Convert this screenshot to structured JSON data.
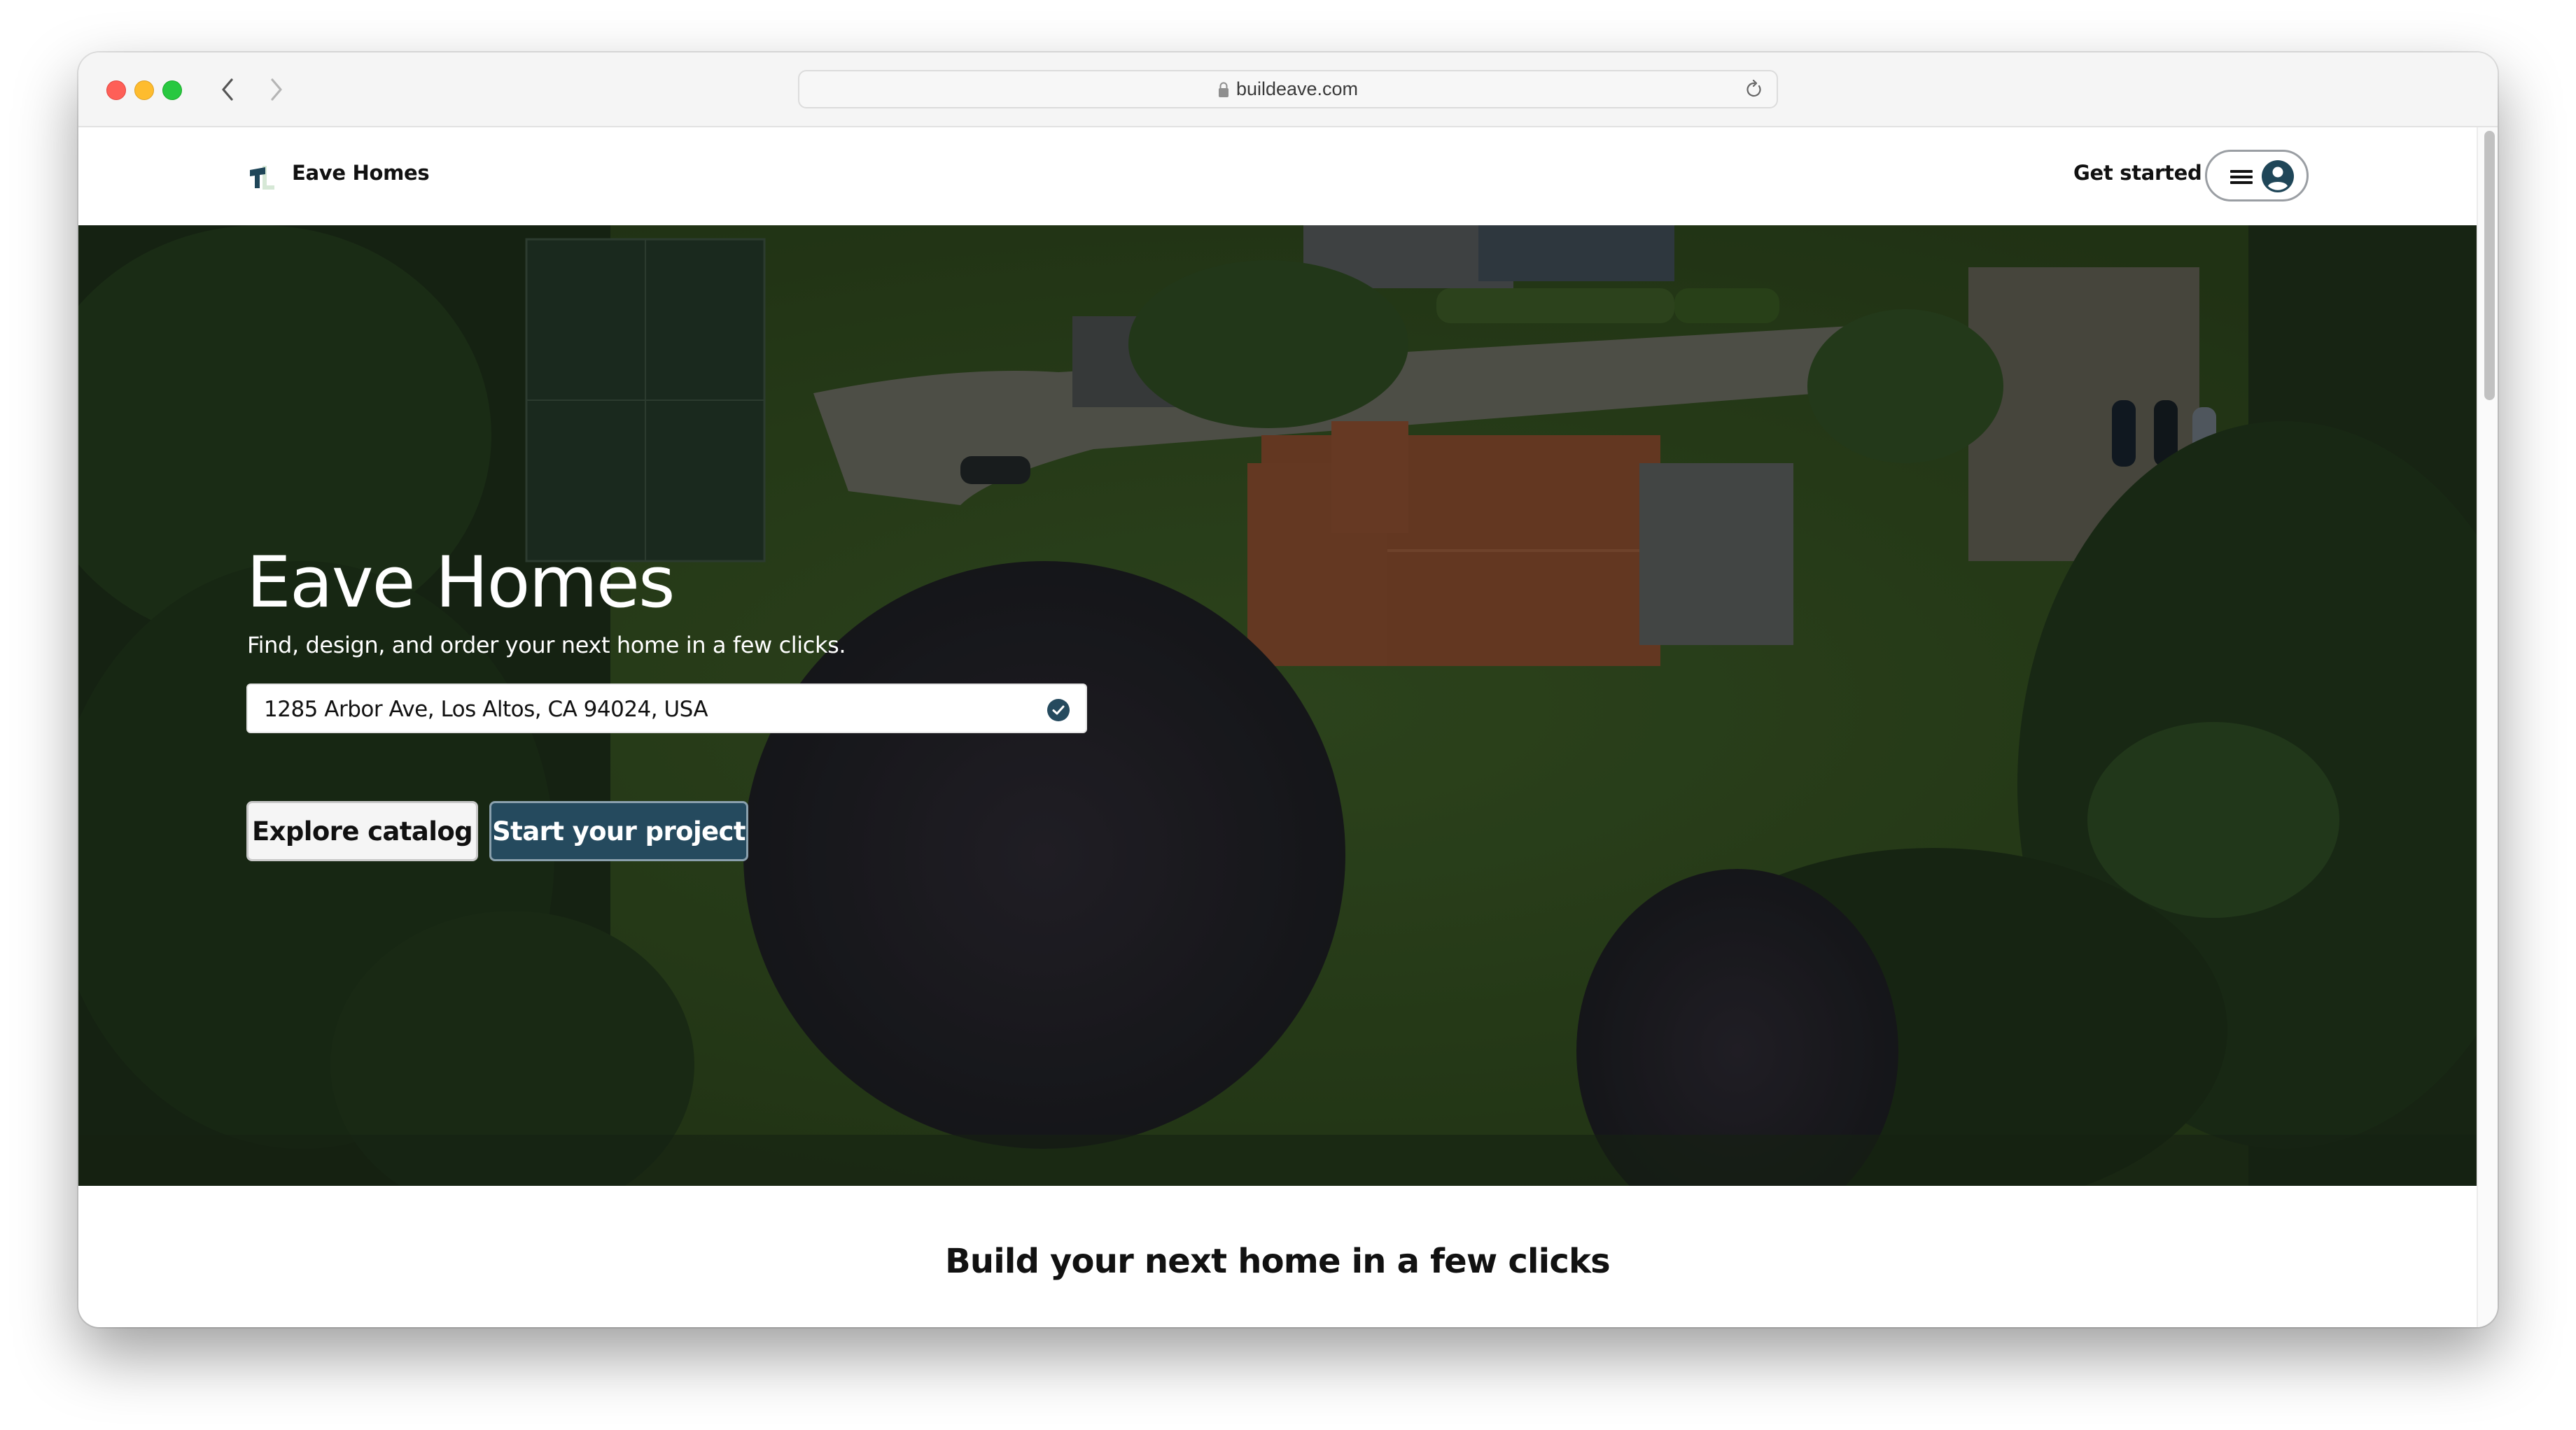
{
  "browser": {
    "url": "buildeave.com",
    "traffic_lights": {
      "close": "#fe5f57",
      "minimize": "#febc2e",
      "maximize": "#28c840"
    },
    "icons": {
      "back": "chevron-left-icon",
      "forward": "chevron-right-icon",
      "lock": "lock-icon",
      "reload": "reload-icon"
    }
  },
  "header": {
    "brand": "Eave Homes",
    "get_started": "Get started",
    "icons": {
      "logo": "eave-logo-icon",
      "menu": "hamburger-icon",
      "account": "user-avatar-icon"
    }
  },
  "hero": {
    "title": "Eave Homes",
    "subtitle": "Find, design, and order your next home in a few clicks.",
    "address_value": "1285 Arbor Ave, Los Altos, CA 94024, USA",
    "address_verified_icon": "check-circle-icon",
    "explore_button": "Explore catalog",
    "start_button": "Start your project"
  },
  "section": {
    "title": "Build your next home in a few clicks"
  },
  "colors": {
    "brand_primary": "#254a5e",
    "logo_accent": "#d6e8d6",
    "text_dark": "#111111"
  }
}
